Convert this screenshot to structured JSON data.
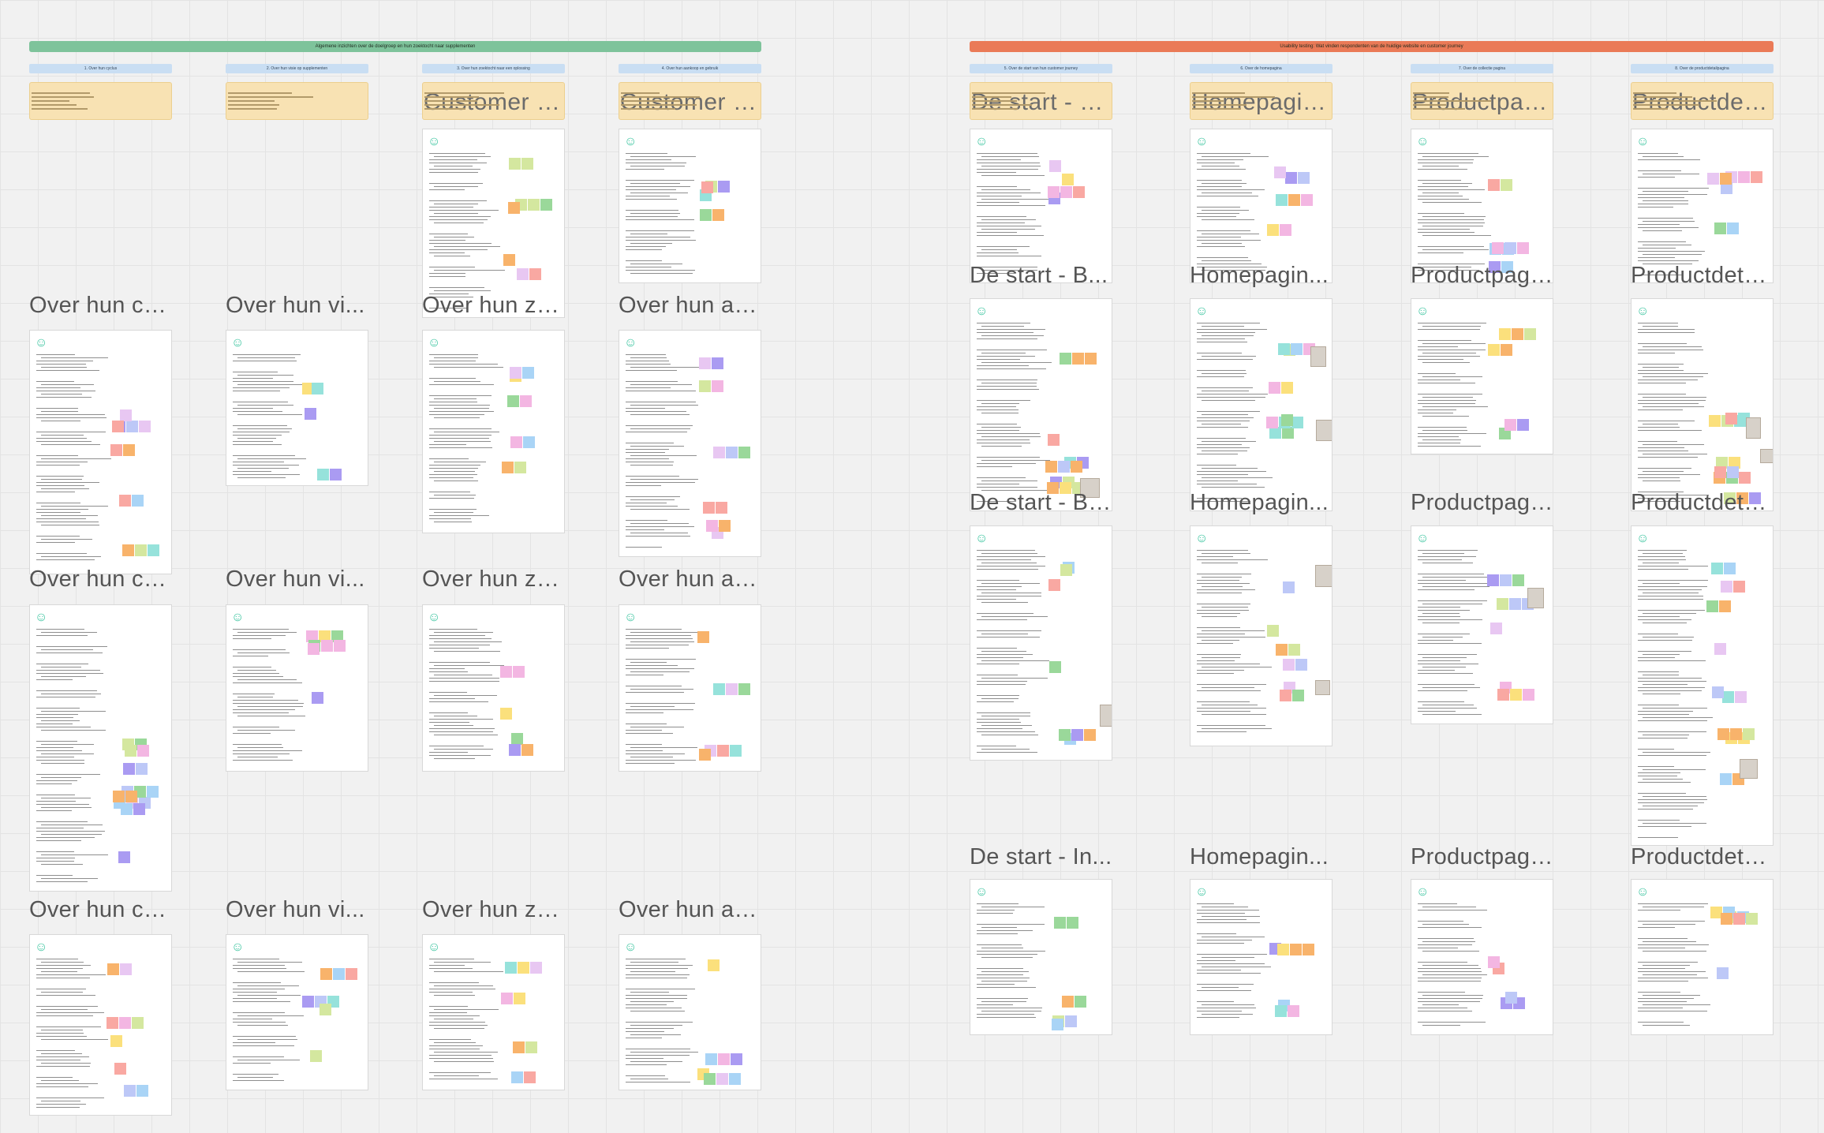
{
  "canvas": {
    "background": "#f1f1f1",
    "grid_color": "#e3e3e3"
  },
  "banners": [
    {
      "text": "Algemene inzichten over de doelgroep en hun zoektocht naar supplementen",
      "color": "#7ec39b"
    },
    {
      "text": "Usability testing: Wat vinden respondenten van de huidige website en customer journey",
      "color": "#ea7a57"
    }
  ],
  "columns": [
    {
      "header": "1. Over hun cyclus",
      "top_card": "",
      "labels": [
        "Over hun cy...",
        "Over hun cy...",
        "Over hun cy..."
      ]
    },
    {
      "header": "2. Over hun visie op supplementen",
      "top_card": "",
      "labels": [
        "Over hun vi...",
        "Over hun vi...",
        "Over hun vi..."
      ]
    },
    {
      "header": "3. Over hun zoektocht naar een oplossing",
      "top_card": "Customer Jo...",
      "labels": [
        "Over hun zo...",
        "Over hun zo...",
        "Over hun zo..."
      ]
    },
    {
      "header": "4. Over hun aankoop en gebruik",
      "top_card": "Customer Jo...",
      "labels": [
        "Over hun aa...",
        "Over hun aa...",
        "Over hun aa..."
      ]
    },
    {
      "header": "5. Over de start van hun customer journey",
      "top_card": "De start - C...",
      "labels": [
        "De start - B...",
        "De start - Ba...",
        "De start - In..."
      ]
    },
    {
      "header": "6. Over de homepagina",
      "top_card": "Homepagin...",
      "labels": [
        "Homepagin...",
        "Homepagin...",
        "Homepagin..."
      ]
    },
    {
      "header": "7. Over de collectie pagina",
      "top_card": "Productpagi...",
      "labels": [
        "Productpagi...",
        "Productpagi...",
        "Productpagi..."
      ]
    },
    {
      "header": "8. Over de productdetailpagina",
      "top_card": "Productdeta...",
      "labels": [
        "Productdeta...",
        "Productdeta...",
        "Productdeta..."
      ]
    }
  ],
  "sticky_colors": [
    "#9ad89a",
    "#f3b6e2",
    "#f9a8a2",
    "#fbe07c",
    "#bdc8f7",
    "#aa9bf2",
    "#96e2db",
    "#d4e79f",
    "#f8b36b",
    "#e8c7f2",
    "#a9d4f6"
  ],
  "icons": {
    "smiley": "smiley-icon"
  }
}
